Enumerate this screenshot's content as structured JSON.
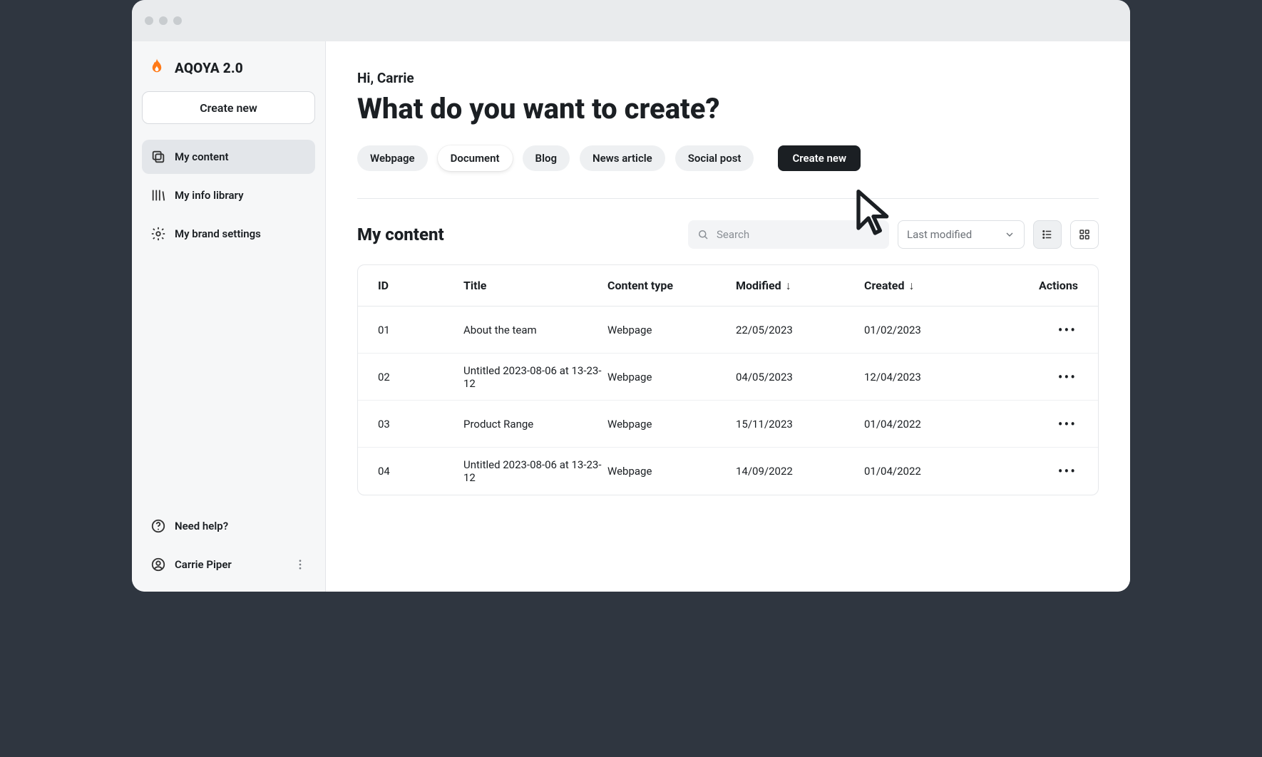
{
  "app": {
    "name": "AQOYA 2.0"
  },
  "sidebar": {
    "create_label": "Create new",
    "items": [
      {
        "label": "My content"
      },
      {
        "label": "My info library"
      },
      {
        "label": "My brand settings"
      }
    ],
    "help_label": "Need help?",
    "user_name": "Carrie Piper"
  },
  "main": {
    "greeting": "Hi, Carrie",
    "headline": "What do you want to create?",
    "chips": [
      {
        "label": "Webpage"
      },
      {
        "label": "Document"
      },
      {
        "label": "Blog"
      },
      {
        "label": "News article"
      },
      {
        "label": "Social post"
      }
    ],
    "create_label": "Create new",
    "content_title": "My content",
    "search_placeholder": "Search",
    "sort_label": "Last modified"
  },
  "table": {
    "columns": {
      "id": "ID",
      "title": "Title",
      "type": "Content type",
      "modified": "Modified",
      "created": "Created",
      "actions": "Actions"
    },
    "rows": [
      {
        "id": "01",
        "title": "About the team",
        "type": "Webpage",
        "modified": "22/05/2023",
        "created": "01/02/2023"
      },
      {
        "id": "02",
        "title": "Untitled 2023-08-06 at 13-23-12",
        "type": "Webpage",
        "modified": "04/05/2023",
        "created": "12/04/2023"
      },
      {
        "id": "03",
        "title": "Product Range",
        "type": "Webpage",
        "modified": "15/11/2023",
        "created": "01/04/2022"
      },
      {
        "id": "04",
        "title": "Untitled 2023-08-06 at 13-23-12",
        "type": "Webpage",
        "modified": "14/09/2022",
        "created": "01/04/2022"
      }
    ]
  }
}
